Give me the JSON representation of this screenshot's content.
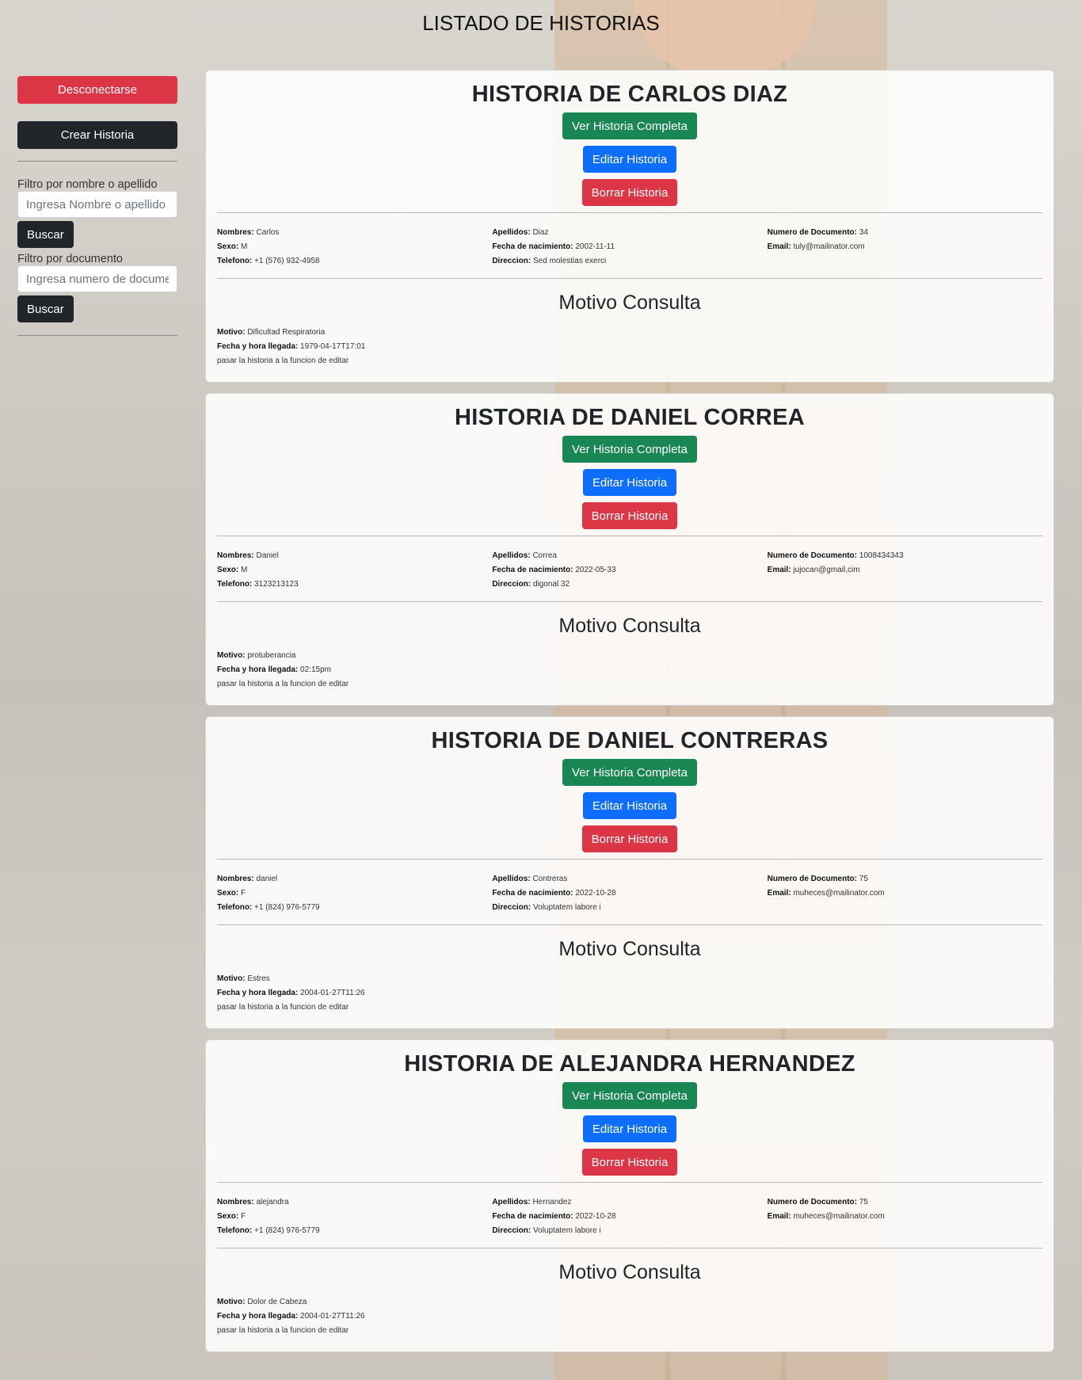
{
  "page": {
    "title": "LISTADO DE HISTORIAS"
  },
  "sidebar": {
    "logout_label": "Desconectarse",
    "create_label": "Crear Historia",
    "name_filter_label": "Filtro por nombre o apellido",
    "name_filter_placeholder": "Ingresa Nombre o apellido",
    "name_filter_value": "",
    "search_label_1": "Buscar",
    "doc_filter_label": "Filtro por documento",
    "doc_filter_placeholder": "Ingresa numero de documento",
    "doc_filter_value": "",
    "search_label_2": "Buscar"
  },
  "labels": {
    "view": "Ver Historia Completa",
    "edit": "Editar Historia",
    "delete": "Borrar Historia",
    "nombres": "Nombres:",
    "sexo": "Sexo:",
    "telefono": "Telefono:",
    "apellidos": "Apellidos:",
    "nacimiento": "Fecha de nacimiento:",
    "direccion": "Direccion:",
    "documento": "Numero de Documento:",
    "email": "Email:",
    "motivo_title": "Motivo Consulta",
    "motivo": "Motivo:",
    "llegada": "Fecha y hora llegada:",
    "nota": "pasar la historia a la funcion de editar"
  },
  "histories": [
    {
      "title": "HISTORIA DE CARLOS DIAZ",
      "nombres": "Carlos",
      "sexo": "M",
      "telefono": "+1 (576) 932-4958",
      "apellidos": "Diaz",
      "nacimiento": "2002-11-11",
      "direccion": "Sed molestias exerci",
      "documento": "34",
      "email": "tuly@mailinator.com",
      "motivo": "Dificultad Respiratoria",
      "llegada": "1979-04-17T17:01"
    },
    {
      "title": "HISTORIA DE DANIEL CORREA",
      "nombres": "Daniel",
      "sexo": "M",
      "telefono": "3123213123",
      "apellidos": "Correa",
      "nacimiento": "2022-05-33",
      "direccion": "digonal 32",
      "documento": "1008434343",
      "email": "jujocan@gmail,cim",
      "motivo": "protuberancia",
      "llegada": "02:15pm"
    },
    {
      "title": "HISTORIA DE DANIEL CONTRERAS",
      "nombres": "daniel",
      "sexo": "F",
      "telefono": "+1 (824) 976-5779",
      "apellidos": "Contreras",
      "nacimiento": "2022-10-28",
      "direccion": "Voluptatem labore i",
      "documento": "75",
      "email": "muheces@mailinator.com",
      "motivo": "Estres",
      "llegada": "2004-01-27T11:26"
    },
    {
      "title": "HISTORIA DE ALEJANDRA HERNANDEZ",
      "nombres": "alejandra",
      "sexo": "F",
      "telefono": "+1 (824) 976-5779",
      "apellidos": "Hernandez",
      "nacimiento": "2022-10-28",
      "direccion": "Voluptatem labore i",
      "documento": "75",
      "email": "muheces@mailinator.com",
      "motivo": "Dolor de Cabeza",
      "llegada": "2004-01-27T11:26"
    }
  ],
  "colors": {
    "danger": "#dc3545",
    "dark": "#212529",
    "success": "#198754",
    "primary": "#0d6efd"
  }
}
